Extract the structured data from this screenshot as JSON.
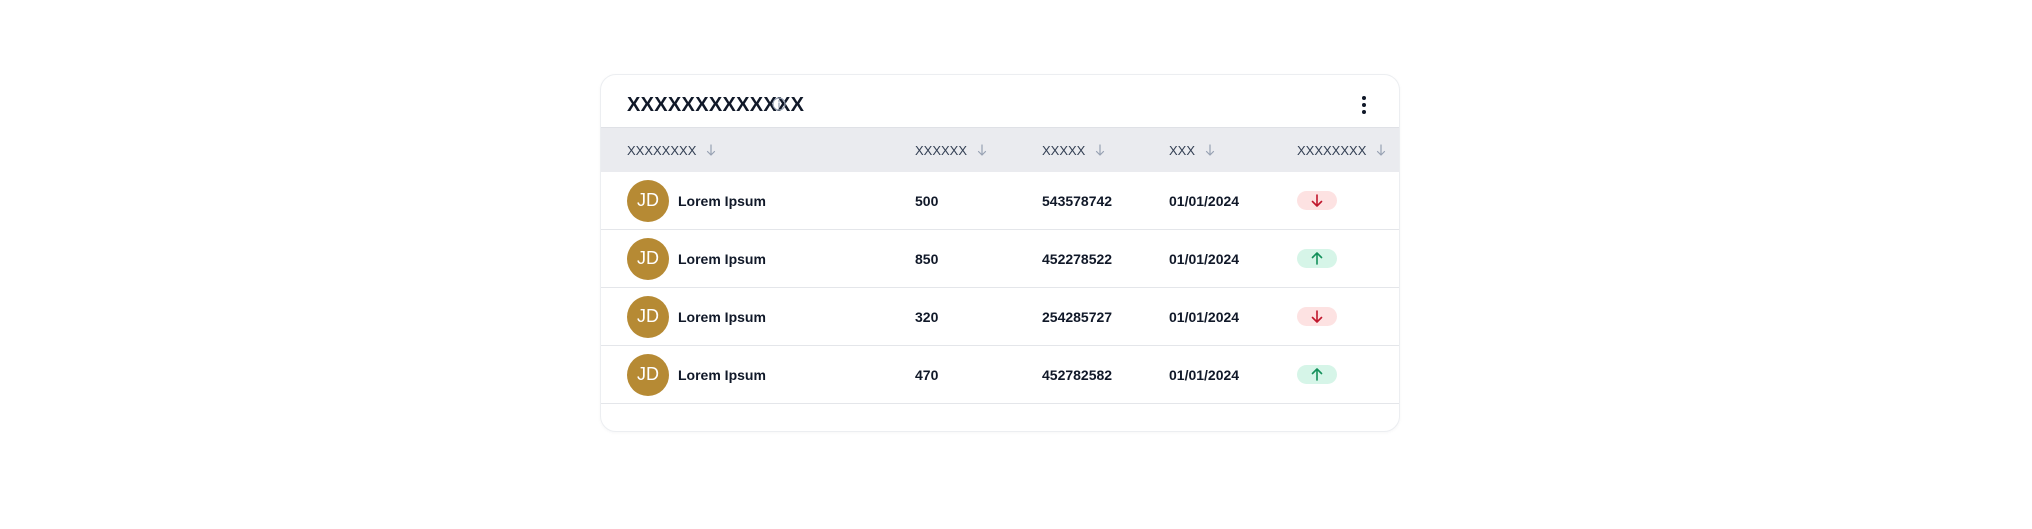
{
  "card": {
    "title": "XXXXXXXXXXXXX",
    "info_icon": "info-circle-icon",
    "menu_icon": "kebab-menu-icon"
  },
  "table": {
    "columns": [
      {
        "label": "XXXXXXXX",
        "sort_icon": "arrow-down-icon"
      },
      {
        "label": "XXXXXX",
        "sort_icon": "arrow-down-icon"
      },
      {
        "label": "XXXXX",
        "sort_icon": "arrow-down-icon"
      },
      {
        "label": "XXX",
        "sort_icon": "arrow-down-icon"
      },
      {
        "label": "XXXXXXXX",
        "sort_icon": "arrow-down-icon"
      }
    ],
    "rows": [
      {
        "initials": "JD",
        "name": "Lorem Ipsum",
        "value": "500",
        "code": "543578742",
        "date": "01/01/2024",
        "trend": "down"
      },
      {
        "initials": "JD",
        "name": "Lorem Ipsum",
        "value": "850",
        "code": "452278522",
        "date": "01/01/2024",
        "trend": "up"
      },
      {
        "initials": "JD",
        "name": "Lorem Ipsum",
        "value": "320",
        "code": "254285727",
        "date": "01/01/2024",
        "trend": "down"
      },
      {
        "initials": "JD",
        "name": "Lorem Ipsum",
        "value": "470",
        "code": "452782582",
        "date": "01/01/2024",
        "trend": "up"
      }
    ]
  },
  "colors": {
    "avatar": "#b68a34",
    "header_bg": "#eaebef",
    "trend_down_bg": "#fde2e2",
    "trend_down_fg": "#c0162c",
    "trend_up_bg": "#d6f5e8",
    "trend_up_fg": "#13905a"
  }
}
